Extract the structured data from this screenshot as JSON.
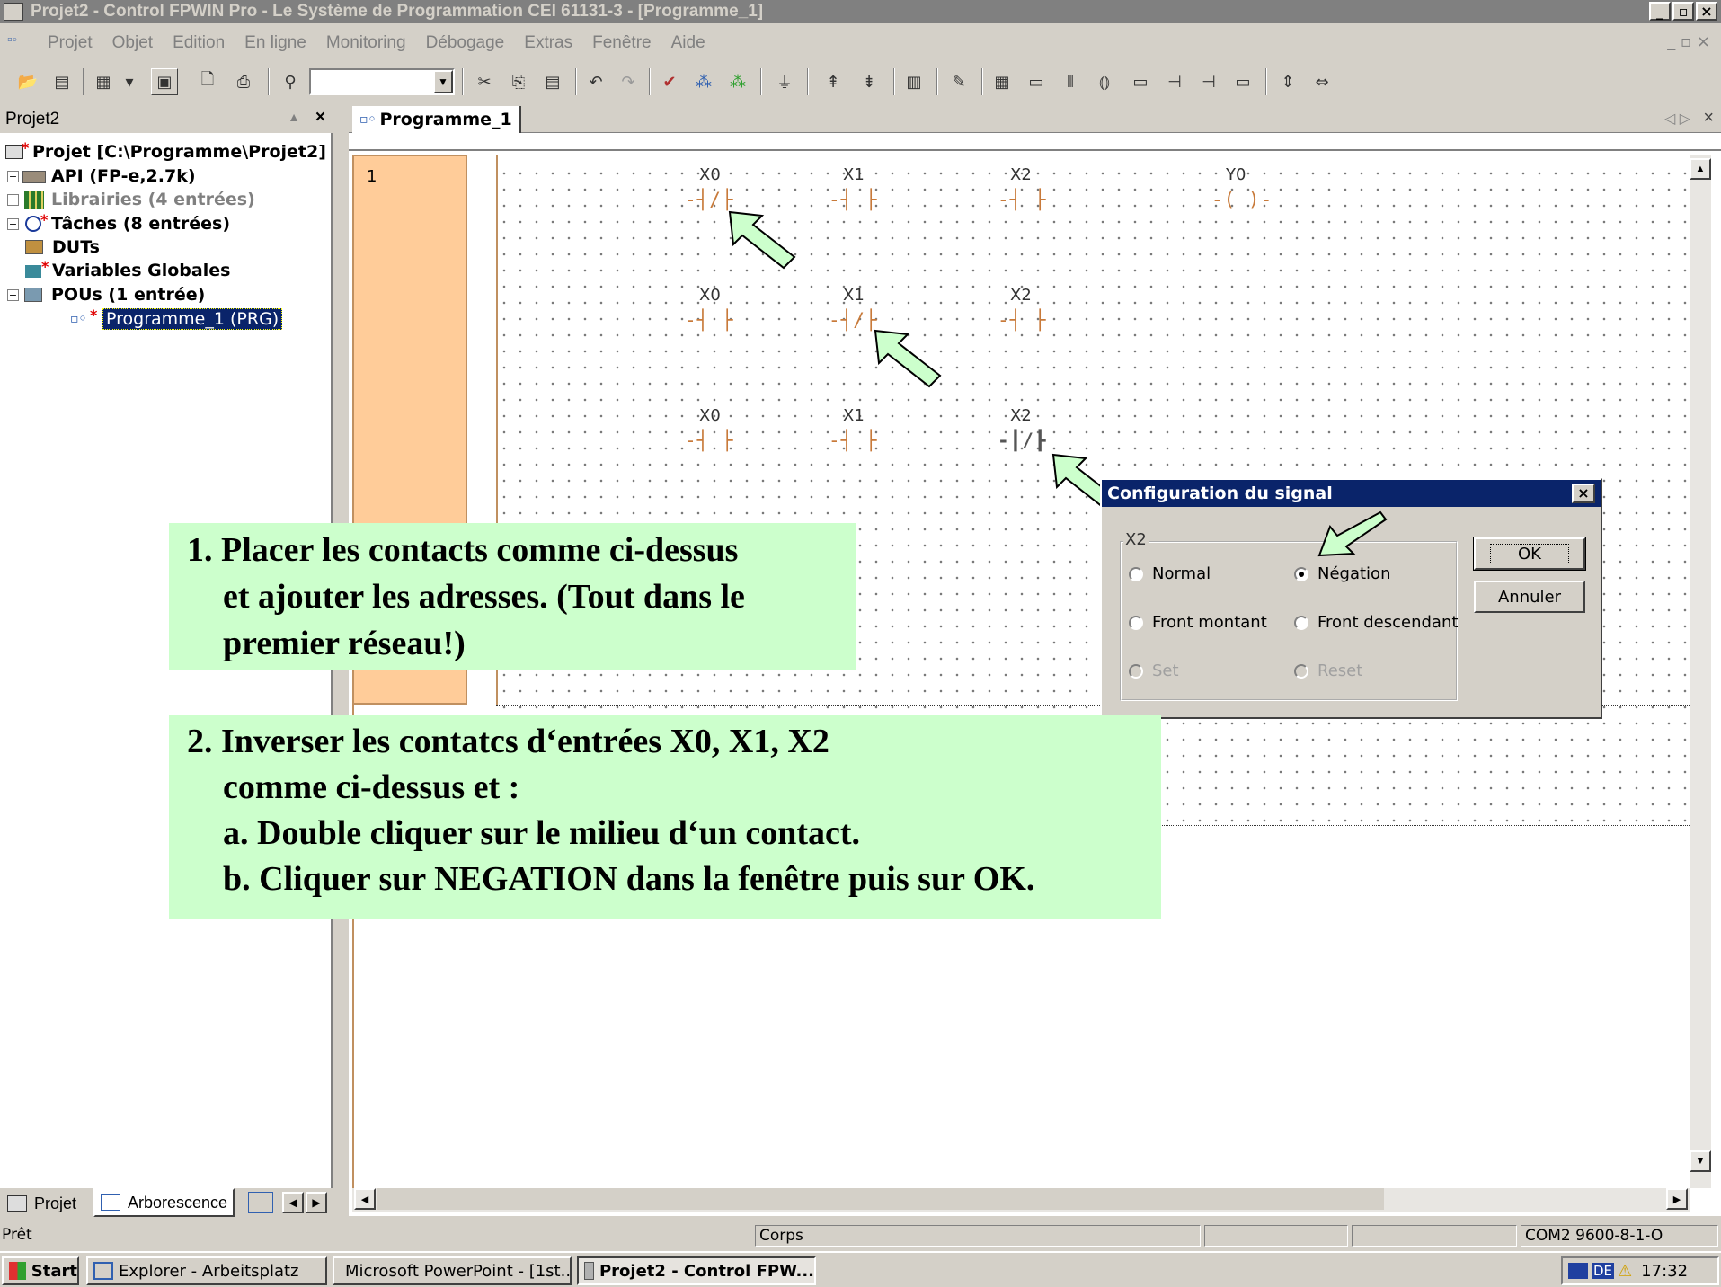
{
  "window": {
    "title": "Projet2 - Control FPWIN Pro - Le Système de Programmation CEI 61131-3 - [Programme_1]"
  },
  "menu": [
    "Projet",
    "Objet",
    "Edition",
    "En ligne",
    "Monitoring",
    "Débogage",
    "Extras",
    "Fenêtre",
    "Aide"
  ],
  "toolbar": {
    "combo_value": ""
  },
  "project_panel": {
    "title": "Projet2",
    "tree": [
      {
        "label": "Projet [C:\\Programme\\Projet2]"
      },
      {
        "label": "API (FP-e,2.7k)"
      },
      {
        "label": "Librairies (4 entrées)"
      },
      {
        "label": "Tâches (8 entrées)"
      },
      {
        "label": "DUTs"
      },
      {
        "label": "Variables Globales"
      },
      {
        "label": "POUs (1 entrée)"
      },
      {
        "label": "Programme_1 (PRG)"
      }
    ],
    "tabs": [
      "Projet",
      "Arborescence"
    ]
  },
  "editor": {
    "tab": "Programme_1",
    "network_number": "1",
    "rows": [
      {
        "contacts": [
          {
            "addr": "X0",
            "negated": true
          },
          {
            "addr": "X1",
            "negated": false
          },
          {
            "addr": "X2",
            "negated": false
          }
        ],
        "coil": "Y0"
      },
      {
        "contacts": [
          {
            "addr": "X0",
            "negated": false
          },
          {
            "addr": "X1",
            "negated": true
          },
          {
            "addr": "X2",
            "negated": false
          }
        ]
      },
      {
        "contacts": [
          {
            "addr": "X0",
            "negated": false
          },
          {
            "addr": "X1",
            "negated": false
          },
          {
            "addr": "X2",
            "negated": true
          }
        ]
      }
    ]
  },
  "dialog": {
    "title": "Configuration du signal",
    "group": "X2",
    "options": [
      "Normal",
      "Négation",
      "Front montant",
      "Front descendant",
      "Set",
      "Reset"
    ],
    "selected": "Négation",
    "ok": "OK",
    "cancel": "Annuler"
  },
  "notes": {
    "note1": [
      "1. Placer les contacts comme ci-dessus",
      "et ajouter les adresses. (Tout dans le",
      "premier réseau!)"
    ],
    "note2": [
      "2. Inverser les contatcs d‘entrées X0, X1, X2",
      "comme ci-dessus et :",
      "a. Double cliquer sur le milieu d‘un contact.",
      "b. Cliquer sur NEGATION dans la fenêtre puis sur OK."
    ]
  },
  "statusbar": {
    "left": "Prêt",
    "center": "Corps",
    "right": "COM2 9600-8-1-O"
  },
  "taskbar": {
    "start": "Start",
    "tasks": [
      "Explorer - Arbeitsplatz",
      "Microsoft PowerPoint - [1st...",
      "Projet2 - Control FPW..."
    ],
    "lang": "DE",
    "clock": "17:32"
  },
  "colors": {
    "note_bg": "#ccffcc",
    "network_col": "#ffcc99",
    "title_active": "#0a246a",
    "arrow": "#ccffcc",
    "contact": "#c87a3a"
  }
}
